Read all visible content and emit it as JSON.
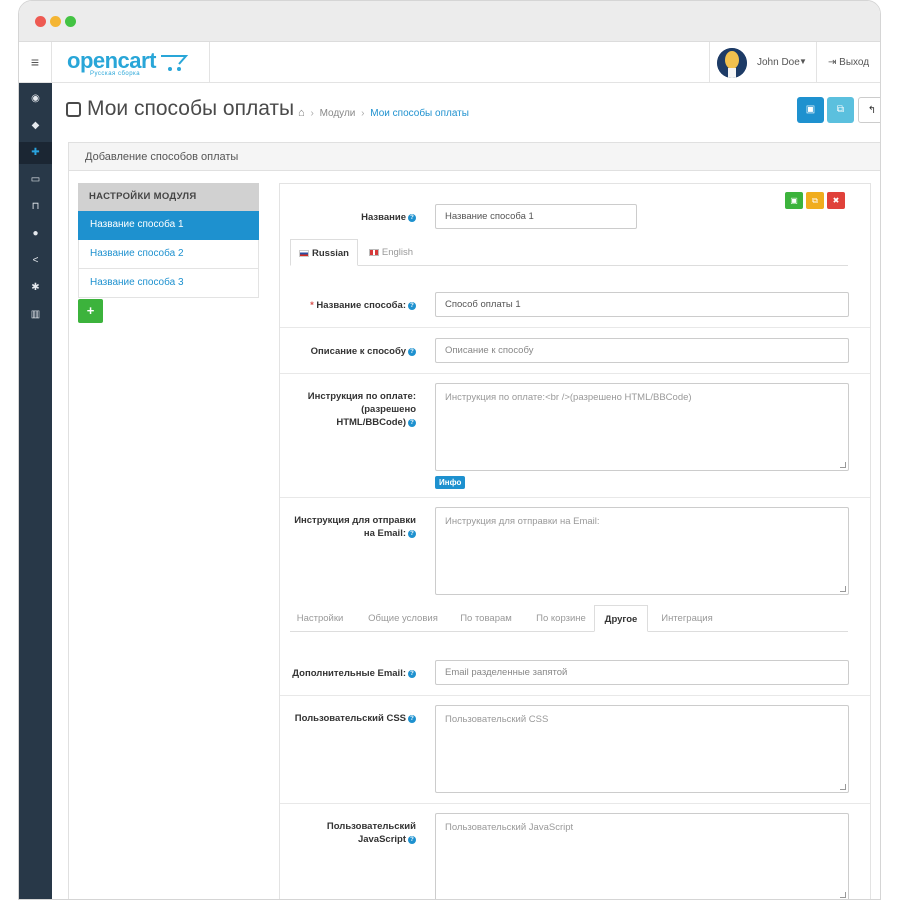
{
  "header": {
    "logo_text": "opencart",
    "logo_sub": "Русская сборка",
    "user_name": "John Doe",
    "logout_label": "Выход"
  },
  "page": {
    "title": "Мои способы оплаты",
    "breadcrumb": [
      "Модули",
      "Мои способы оплаты"
    ]
  },
  "panel": {
    "heading": "Добавление способов оплаты"
  },
  "left_nav": {
    "heading": "НАСТРОЙКИ МОДУЛЯ",
    "items": [
      "Название способа 1",
      "Название способа 2",
      "Название способа 3"
    ],
    "active_index": 0
  },
  "form": {
    "name": {
      "label": "Название",
      "value": "Название способа 1"
    },
    "lang_tabs": [
      "Russian",
      "English"
    ],
    "method_name": {
      "label": "Название способа:",
      "value": "Способ оплаты 1"
    },
    "description": {
      "label": "Описание к способу",
      "placeholder": "Описание к способу"
    },
    "instruction": {
      "label_lines": [
        "Инструкция по оплате:",
        "(разрешено",
        "HTML/BBCode)"
      ],
      "placeholder": "Инструкция по оплате:<br />(разрешено HTML/BBCode)",
      "badge": "Инфо"
    },
    "email_instruction": {
      "label_lines": [
        "Инструкция для отправки",
        "на Email:"
      ],
      "placeholder": "Инструкция для отправки на Email:"
    },
    "section_tabs": [
      "Настройки",
      "Общие условия",
      "По товарам",
      "По корзине",
      "Другое",
      "Интеграция"
    ],
    "section_active_index": 4,
    "extra_email": {
      "label": "Дополнительные Email:",
      "placeholder": "Email разделенные запятой"
    },
    "custom_css": {
      "label": "Пользовательский CSS",
      "placeholder": "Пользовательский CSS"
    },
    "custom_js": {
      "label_lines": [
        "Пользовательский",
        "JavaScript"
      ],
      "placeholder": "Пользовательский JavaScript"
    }
  },
  "colors": {
    "primary": "#1e91cf",
    "success": "#3cb33c",
    "warning": "#f0ad1e",
    "danger": "#e0413a",
    "sidebar": "#283848"
  },
  "icons": {
    "sidebar": [
      "dashboard-icon",
      "tags-icon",
      "puzzle-icon",
      "desktop-icon",
      "cart-icon",
      "user-icon",
      "share-icon",
      "cog-icon",
      "bar-chart-icon"
    ],
    "toolbar": [
      "save-icon",
      "copy-icon",
      "back-icon"
    ],
    "row_actions": [
      "save-icon",
      "copy-icon",
      "trash-icon"
    ]
  }
}
